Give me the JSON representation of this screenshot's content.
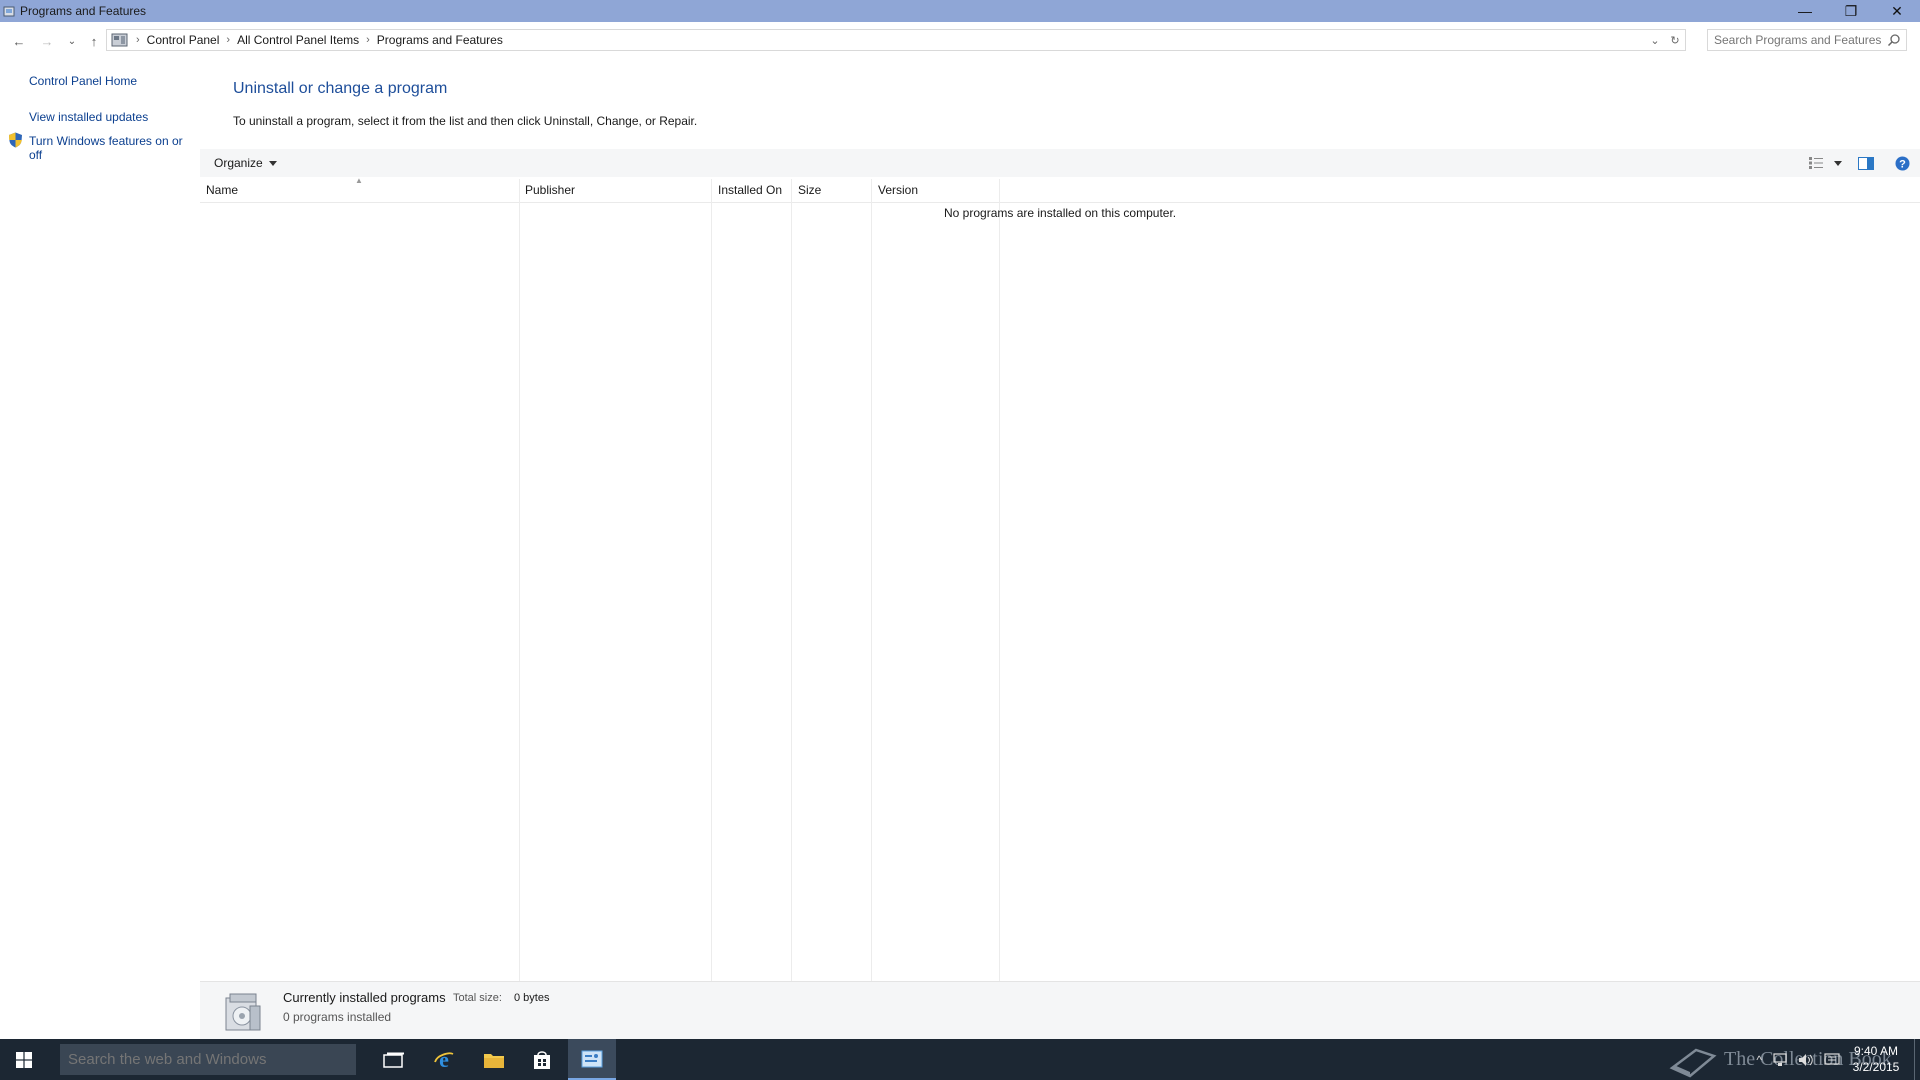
{
  "window": {
    "title": "Programs and Features",
    "controls": {
      "minimize": "—",
      "restore": "❐",
      "close": "✕"
    }
  },
  "address": {
    "nav": {
      "back": "←",
      "forward": "→",
      "recent": "⌄",
      "up": "↑"
    },
    "breadcrumb": [
      "Control Panel",
      "All Control Panel Items",
      "Programs and Features"
    ],
    "separator": "›",
    "search_placeholder": "Search Programs and Features"
  },
  "left_pane": {
    "home": "Control Panel Home",
    "view_updates": "View installed updates",
    "features_line1": "Turn Windows features on or",
    "features_line2": "off"
  },
  "main": {
    "title": "Uninstall or change a program",
    "description": "To uninstall a program, select it from the list and then click Uninstall, Change, or Repair.",
    "toolbar": {
      "organize": "Organize"
    },
    "columns": [
      "Name",
      "Publisher",
      "Installed On",
      "Size",
      "Version"
    ],
    "sorted_column": "Name",
    "empty_message": "No programs are installed on this computer."
  },
  "details": {
    "title": "Currently installed programs",
    "total_size_label": "Total size:",
    "total_size_value": "0 bytes",
    "count": "0 programs installed"
  },
  "taskbar": {
    "search_placeholder": "Search the web and Windows",
    "apps": [
      "task-view",
      "internet-explorer",
      "file-explorer",
      "store",
      "control-panel"
    ],
    "active_app": "control-panel",
    "watermark": "The Collection Book",
    "clock_time": "9:40 AM",
    "clock_date": "3/2/2015"
  },
  "colors": {
    "titlebar": "#8fa6d6",
    "link": "#0b3f8f",
    "heading": "#1e4e9a",
    "taskbar": "#1c2733"
  }
}
